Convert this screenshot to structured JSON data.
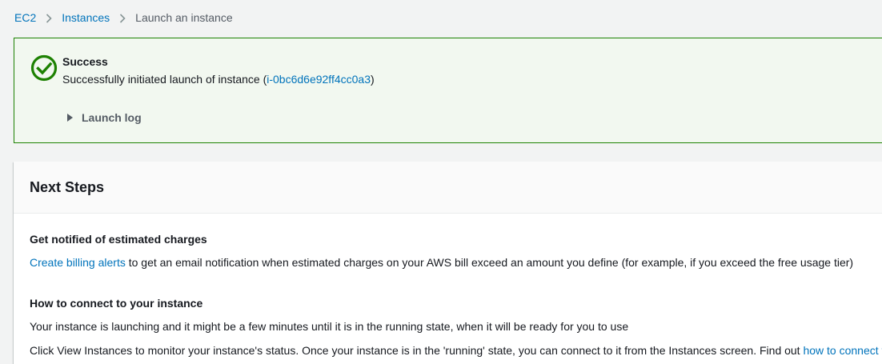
{
  "breadcrumb": {
    "items": [
      {
        "label": "EC2"
      },
      {
        "label": "Instances"
      },
      {
        "label": "Launch an instance"
      }
    ]
  },
  "flash": {
    "status": "success",
    "title": "Success",
    "message_prefix": "Successfully initiated launch of instance (",
    "instance_id": "i-0bc6d6e92ff4cc0a3",
    "message_suffix": ")",
    "launch_log_label": "Launch log"
  },
  "next_steps": {
    "title": "Next Steps",
    "billing": {
      "heading": "Get notified of estimated charges",
      "link": "Create billing alerts",
      "text": " to get an email notification when estimated charges on your AWS bill exceed an amount you define (for example, if you exceed the free usage tier)"
    },
    "connect": {
      "heading": "How to connect to your instance",
      "line1": "Your instance is launching and it might be a few minutes until it is in the running state, when it will be ready for you to use",
      "line2": "Click View Instances to monitor your instance's status. Once your instance is in the 'running' state, you can connect to it from the Instances screen. Find out ",
      "line2_link": "how to connect to your instance"
    }
  },
  "colors": {
    "link": "#0073bb",
    "success": "#1d8102",
    "success_bg": "#f2f8f0",
    "text": "#16191f",
    "muted": "#545b64"
  },
  "icons": {
    "success": "check-circle-icon",
    "separator": "chevron-right-icon",
    "expand": "caret-right-icon"
  }
}
